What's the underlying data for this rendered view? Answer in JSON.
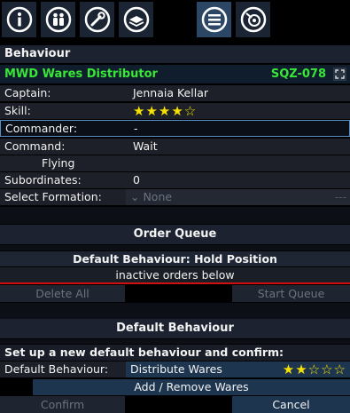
{
  "toolbar": {
    "tools": [
      {
        "icon": "info-icon"
      },
      {
        "icon": "crew-icon"
      },
      {
        "icon": "wrench-icon"
      },
      {
        "icon": "cargo-icon"
      },
      {
        "icon": "behaviour-list-icon",
        "active": true
      },
      {
        "icon": "target-icon"
      }
    ]
  },
  "behaviour": {
    "header": "Behaviour",
    "ship_name": "MWD Wares Distributor",
    "ship_code": "SQZ-078"
  },
  "fields": {
    "captain_label": "Captain:",
    "captain_value": "Jennaia Kellar",
    "skill_label": "Skill:",
    "skill_stars": "★★★★☆",
    "commander_label": "Commander:",
    "commander_value": "-",
    "command_label": "Command:",
    "command_value": "Wait",
    "flying_label": "Flying",
    "subordinates_label": "Subordinates:",
    "subordinates_value": "0",
    "formation_label": "Select Formation:",
    "formation_value": "⌄ None",
    "formation_dash": "---"
  },
  "order_queue": {
    "title": "Order Queue",
    "default_behaviour_line": "Default Behaviour: Hold Position",
    "inactive_text": "inactive orders below",
    "delete_all": "Delete All",
    "start_queue": "Start Queue"
  },
  "default_behaviour": {
    "title": "Default Behaviour",
    "setup_text": "Set up a new default behaviour and confirm:",
    "label": "Default Behaviour:",
    "value": "Distribute Wares",
    "stars": "★★☆☆☆",
    "add_remove": "Add / Remove Wares",
    "confirm": "Confirm",
    "cancel": "Cancel"
  },
  "colors": {
    "accent_green": "#38e638",
    "star_yellow": "#f6e000",
    "active_blue": "#2c4766",
    "red_line": "#d01010"
  }
}
